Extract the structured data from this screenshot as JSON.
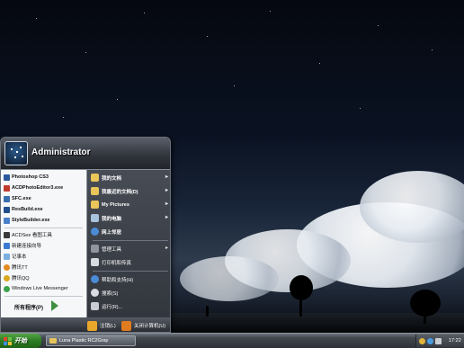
{
  "user": {
    "name": "Administrator"
  },
  "pinned": [
    {
      "label": "Photoshop CS3",
      "icon": "photoshop-icon",
      "color": "#2b5a9c"
    },
    {
      "label": "ACDPhotoEditor3.exe",
      "icon": "acd-photo-editor-icon",
      "color": "#c03a2b"
    },
    {
      "label": "SFC.exe",
      "icon": "sfc-icon",
      "color": "#3a6fb0"
    },
    {
      "label": "ResBuild.exe",
      "icon": "resbuild-icon",
      "color": "#1f4f8f"
    },
    {
      "label": "StyleBuilder.exe",
      "icon": "stylebuilder-icon",
      "color": "#4a7fc9"
    }
  ],
  "recent": [
    {
      "label": "ACDSee 看图工具",
      "icon": "acdsee-icon",
      "color": "#3a3a3a"
    },
    {
      "label": "新建连接向导",
      "icon": "network-wizard-icon",
      "color": "#3b7ad3"
    },
    {
      "label": "记事本",
      "icon": "notepad-icon",
      "color": "#7ab0e0"
    },
    {
      "label": "腾讯TT",
      "icon": "tencent-tt-icon",
      "color": "#e48b20"
    },
    {
      "label": "腾讯QQ",
      "icon": "qq-icon",
      "color": "#d8a81f"
    },
    {
      "label": "Windows Live Messenger",
      "icon": "messenger-icon",
      "color": "#3aa24a"
    }
  ],
  "all_programs": "所有程序(P)",
  "places": [
    {
      "label": "我的文档",
      "icon": "my-documents-icon",
      "color": "#e9c55a",
      "bold": true,
      "arrow": "▸"
    },
    {
      "label": "我最近的文档(D)",
      "icon": "recent-documents-icon",
      "color": "#e9c55a",
      "bold": true,
      "arrow": "▸"
    },
    {
      "label": "My Pictures",
      "icon": "my-pictures-icon",
      "color": "#e9c55a",
      "bold": true,
      "arrow": "▸"
    },
    {
      "label": "我的电脑",
      "icon": "my-computer-icon",
      "color": "#a9c3dd",
      "bold": true,
      "arrow": "▸"
    },
    {
      "label": "网上邻居",
      "icon": "network-places-icon",
      "color": "#4b8bd6",
      "bold": true,
      "arrow": ""
    },
    {
      "label": "管理工具",
      "icon": "admin-tools-icon",
      "color": "#8f959e",
      "bold": false,
      "arrow": "▸"
    },
    {
      "label": "打印机和传真",
      "icon": "printer-icon",
      "color": "#d6d9dd",
      "bold": false,
      "arrow": ""
    },
    {
      "label": "帮助和支持(H)",
      "icon": "help-icon",
      "color": "#4b8bd6",
      "bold": false,
      "arrow": ""
    },
    {
      "label": "搜索(S)",
      "icon": "search-icon",
      "color": "#d9dce0",
      "bold": false,
      "arrow": ""
    },
    {
      "label": "运行(R)...",
      "icon": "run-icon",
      "color": "#c9ccd1",
      "bold": false,
      "arrow": ""
    }
  ],
  "footer": {
    "logoff": "注销(L)",
    "shutdown": "关闭计算机(U)"
  },
  "taskbar": {
    "start": "开始",
    "window": "Luna Plastic RC2Gray",
    "clock": "17:22"
  },
  "colors": {
    "start_green": "#2d7d24",
    "logoff": "#e8a72a",
    "shutdown": "#e07b1f"
  }
}
